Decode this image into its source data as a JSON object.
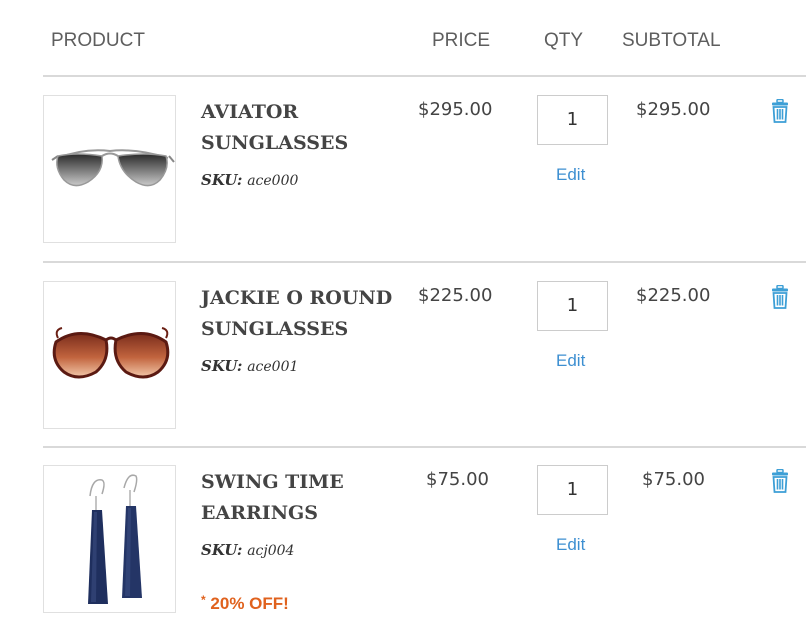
{
  "header": {
    "product": "PRODUCT",
    "price": "PRICE",
    "qty": "QTY",
    "subtotal": "SUBTOTAL"
  },
  "items": [
    {
      "name": "AVIATOR SUNGLASSES",
      "sku_label": "SKU:",
      "sku": "ace000",
      "price": "$295.00",
      "qty": "1",
      "edit": "Edit",
      "subtotal": "$295.00",
      "image_icon": "aviator-sunglasses-image"
    },
    {
      "name": "JACKIE O ROUND SUNGLASSES",
      "sku_label": "SKU:",
      "sku": "ace001",
      "price": "$225.00",
      "qty": "1",
      "edit": "Edit",
      "subtotal": "$225.00",
      "image_icon": "round-sunglasses-image"
    },
    {
      "name": "SWING TIME EARRINGS",
      "sku_label": "SKU:",
      "sku": "acj004",
      "price": "$75.00",
      "qty": "1",
      "edit": "Edit",
      "subtotal": "$75.00",
      "image_icon": "drop-earrings-image",
      "discount_mark": "*",
      "discount": "20% OFF!"
    }
  ],
  "colors": {
    "link": "#3d8fd1",
    "discount": "#e0621e",
    "divider": "#d9d9d9",
    "trash": "#3d9fd6"
  },
  "icons": {
    "delete": "trash-icon"
  }
}
